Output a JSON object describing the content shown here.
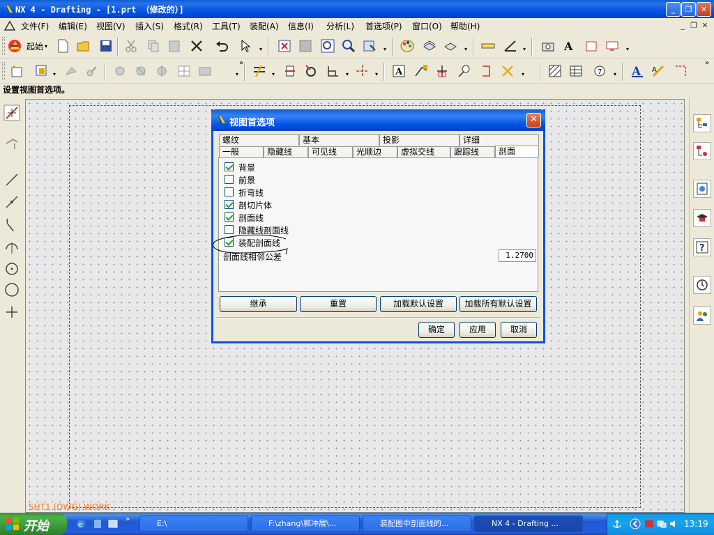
{
  "window": {
    "title": "NX 4 - Drafting - [1.prt （修改的）]",
    "min": "_",
    "max": "❐",
    "close": "✕"
  },
  "menu": [
    "文件(F)",
    "编辑(E)",
    "视图(V)",
    "插入(S)",
    "格式(R)",
    "工具(T)",
    "装配(A)",
    "信息(I)",
    "分析(L)",
    "首选项(P)",
    "窗口(O)",
    "帮助(H)"
  ],
  "toolbar": {
    "start_label": "起始"
  },
  "cue_line": "设置视图首选项。",
  "canvas": {
    "sheet_label": "SHT1 (DWG) WORK"
  },
  "dialog": {
    "title": "视图首选项",
    "tabs_row1": [
      "螺纹",
      "基本",
      "投影",
      "详细"
    ],
    "tabs_row2": [
      "一般",
      "隐藏线",
      "可见线",
      "光顺边",
      "虚拟交线",
      "跟踪线",
      "剖面"
    ],
    "active_tab": "剖面",
    "checkboxes": [
      {
        "label": "背景",
        "checked": true
      },
      {
        "label": "前景",
        "checked": false
      },
      {
        "label": "折弯线",
        "checked": false
      },
      {
        "label": "剖切片体",
        "checked": true
      },
      {
        "label": "剖面线",
        "checked": true
      },
      {
        "label": "隐藏线剖面线",
        "checked": false
      },
      {
        "label": "装配剖面线",
        "checked": true
      }
    ],
    "tolerance_label": "剖面线相邻公差",
    "tolerance_value": "1.2700",
    "buttons_row1": [
      "继承",
      "重置",
      "加载默认设置",
      "加载所有默认设置"
    ],
    "buttons_row2": [
      "确定",
      "应用",
      "取消"
    ]
  },
  "taskbar": {
    "start": "开始",
    "items": [
      "E:\\",
      "F:\\zhang\\郭冲展\\...",
      "装配图中剖面线的...",
      "NX 4 - Drafting ..."
    ],
    "clock": "13:19"
  },
  "colors": {
    "accent": "#0054e3",
    "sheet_label": "#ff7a1a",
    "check": "#21a121"
  }
}
